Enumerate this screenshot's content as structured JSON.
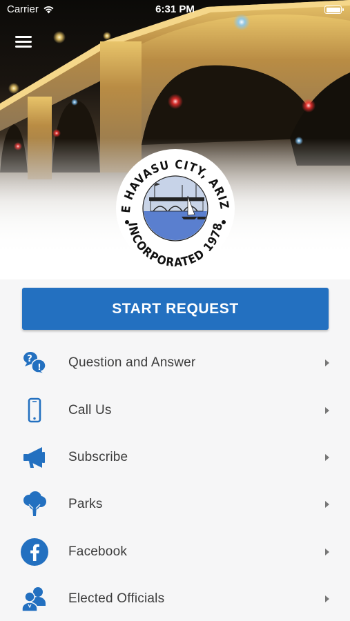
{
  "status_bar": {
    "carrier": "Carrier",
    "time": "6:31 PM"
  },
  "seal": {
    "top_text": "LAKE HAVASU CITY, ARIZONA",
    "bottom_text": "INCORPORATED 1978"
  },
  "start_request": {
    "label": "START REQUEST"
  },
  "menu": {
    "items": [
      {
        "label": "Question and Answer",
        "icon": "question-answer-icon"
      },
      {
        "label": "Call Us",
        "icon": "phone-icon"
      },
      {
        "label": "Subscribe",
        "icon": "megaphone-icon"
      },
      {
        "label": "Parks",
        "icon": "tree-icon"
      },
      {
        "label": "Facebook",
        "icon": "facebook-icon"
      },
      {
        "label": "Elected Officials",
        "icon": "officials-icon"
      }
    ]
  },
  "colors": {
    "accent": "#2370c0",
    "icon_blue": "#2370c0",
    "background": "#f6f6f7"
  }
}
